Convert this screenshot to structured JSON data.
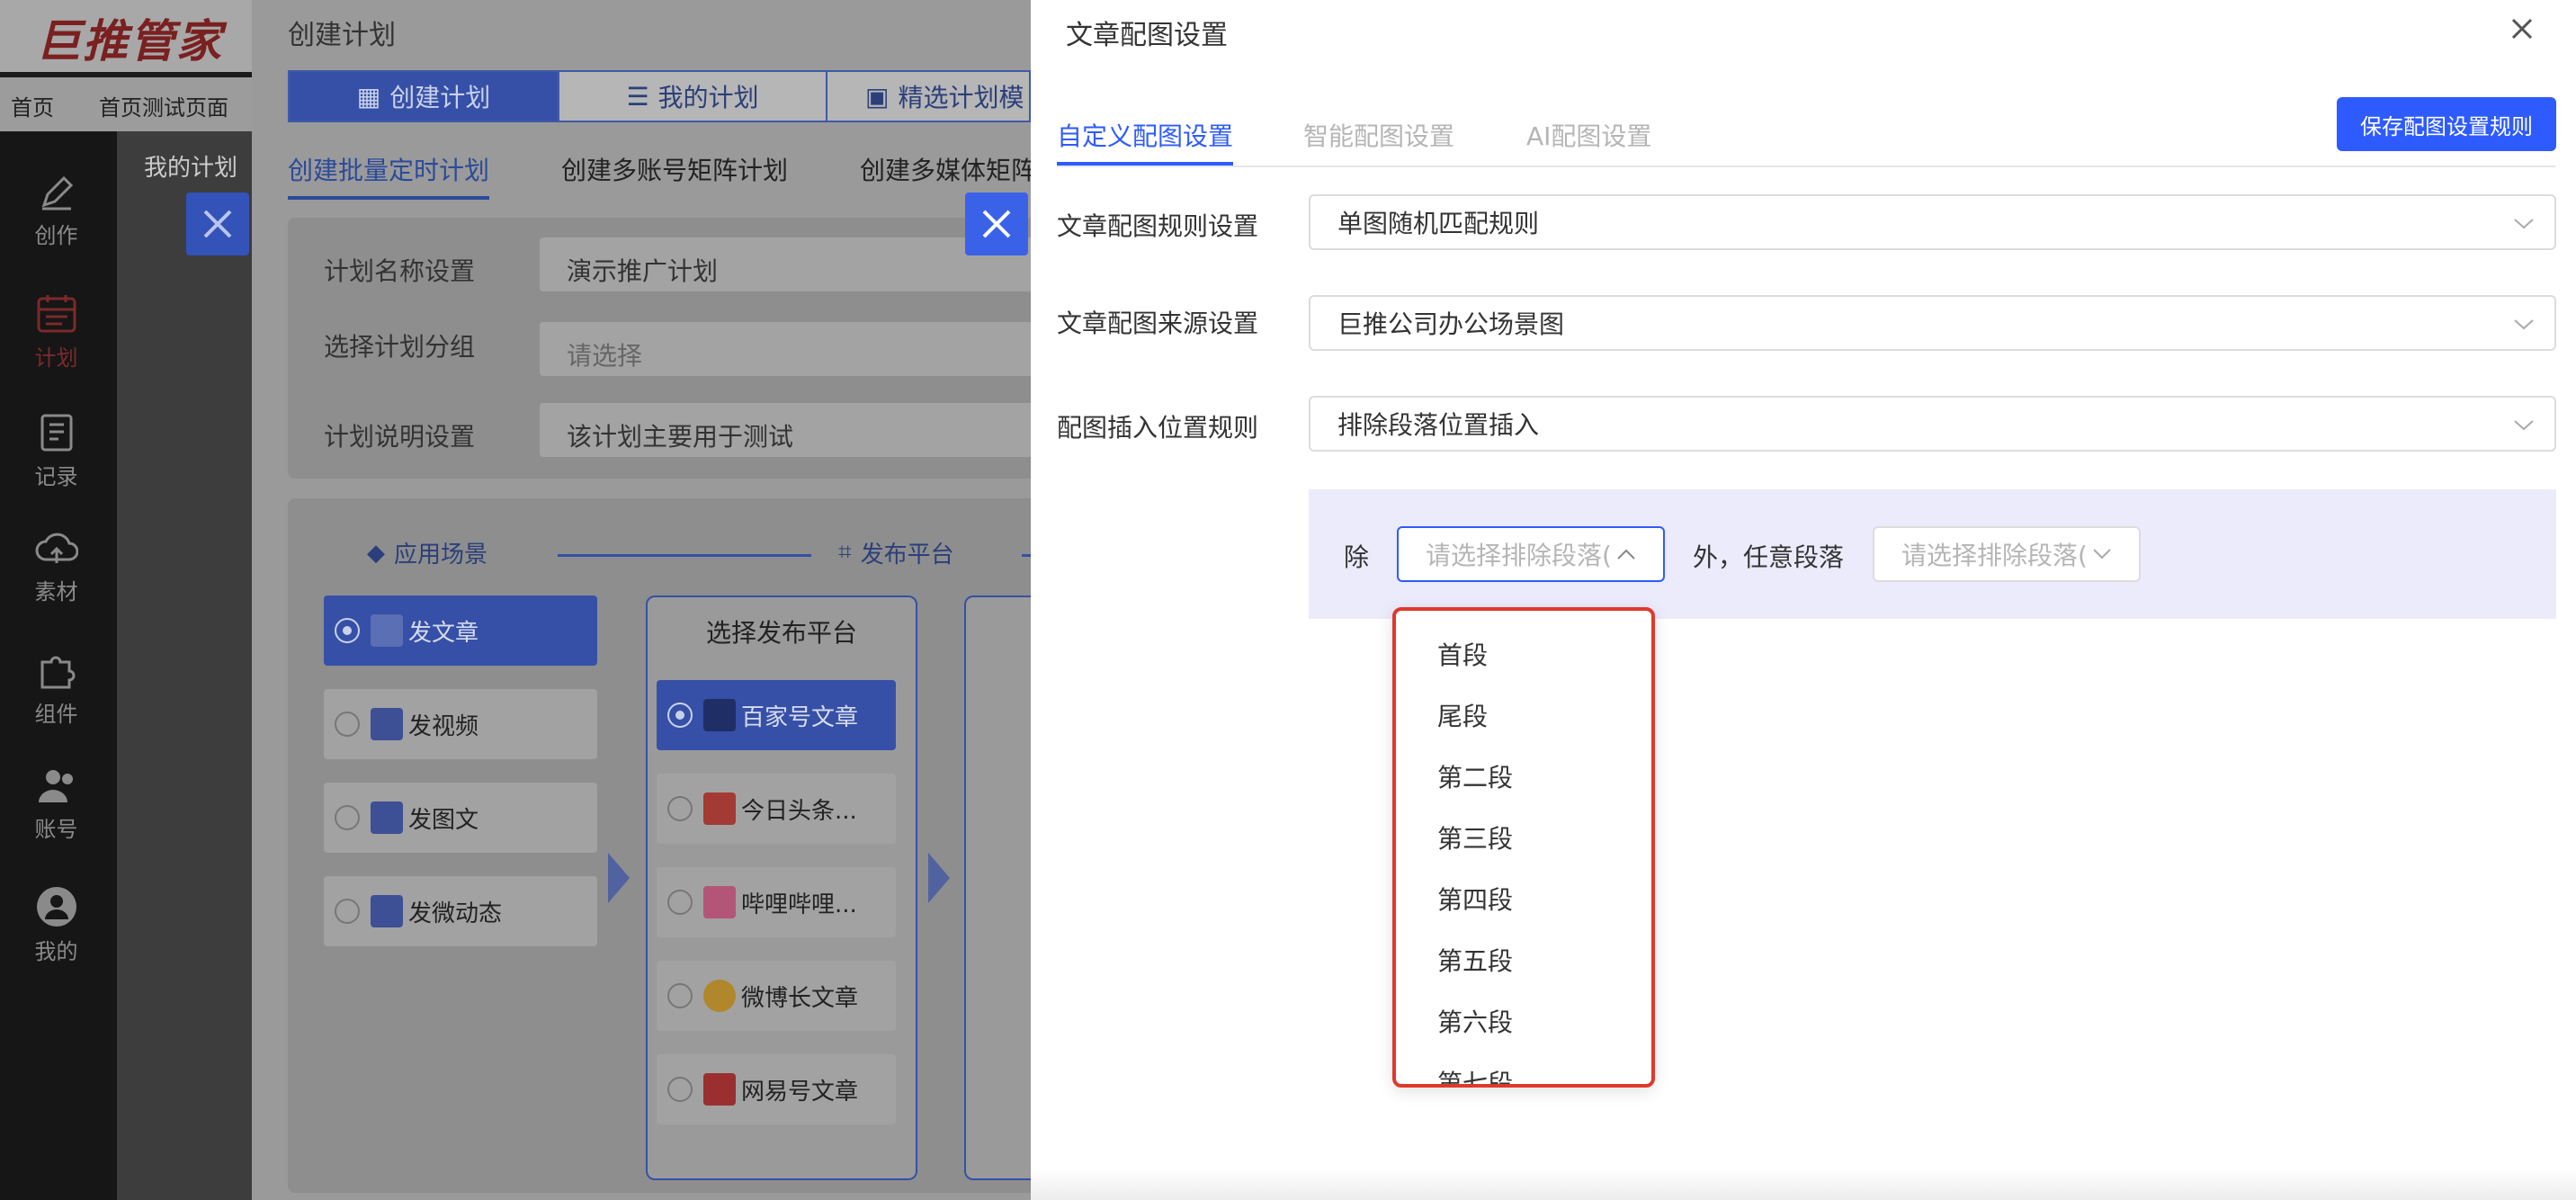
{
  "background": {
    "logo": "巨推管家",
    "nav_tabs": [
      "首页",
      "首页测试页面"
    ],
    "sidebar": [
      {
        "label": "创作",
        "icon": "pen-icon"
      },
      {
        "label": "计划",
        "icon": "calendar-icon"
      },
      {
        "label": "记录",
        "icon": "clipboard-icon"
      },
      {
        "label": "素材",
        "icon": "cloud-upload-icon"
      },
      {
        "label": "组件",
        "icon": "puzzle-icon"
      },
      {
        "label": "账号",
        "icon": "users-icon"
      },
      {
        "label": "我的",
        "icon": "user-icon"
      }
    ],
    "my_plans_label": "我的计划",
    "create_plan": {
      "title": "创建计划",
      "tabs": [
        "创建计划",
        "我的计划",
        "精选计划模"
      ],
      "subtabs": [
        "创建批量定时计划",
        "创建多账号矩阵计划",
        "创建多媒体矩阵"
      ],
      "fields": [
        {
          "label": "计划名称设置",
          "value": "演示推广计划",
          "placeholder": ""
        },
        {
          "label": "选择计划分组",
          "value": "",
          "placeholder": "请选择"
        },
        {
          "label": "计划说明设置",
          "value": "该计划主要用于测试",
          "placeholder": ""
        }
      ],
      "steps": [
        "应用场景",
        "发布平台"
      ],
      "scenes": [
        "发文章",
        "发视频",
        "发图文",
        "发微动态"
      ],
      "platform_box_title": "选择发布平台",
      "platforms": [
        "百家号文章",
        "今日头条...",
        "哔哩哔哩...",
        "微博长文章",
        "网易号文章"
      ]
    }
  },
  "drawer": {
    "title": "文章配图设置",
    "tabs": [
      "自定义配图设置",
      "智能配图设置",
      "AI配图设置"
    ],
    "save_button": "保存配图设置规则",
    "rows": [
      {
        "label": "文章配图规则设置",
        "value": "单图随机匹配规则"
      },
      {
        "label": "文章配图来源设置",
        "value": "巨推公司办公场景图"
      },
      {
        "label": "配图插入位置规则",
        "value": "排除段落位置插入"
      }
    ],
    "exclude_prefix": "除",
    "exclude_placeholder": "请选择排除段落(",
    "middle_text": "外，任意段落",
    "any_placeholder": "请选择排除段落(",
    "dropdown_options": [
      "首段",
      "尾段",
      "第二段",
      "第三段",
      "第四段",
      "第五段",
      "第六段",
      "第七段"
    ]
  },
  "colors": {
    "accent": "#2e5bff",
    "highlight_border": "#e0382d",
    "except_bg": "#ecebfc"
  }
}
